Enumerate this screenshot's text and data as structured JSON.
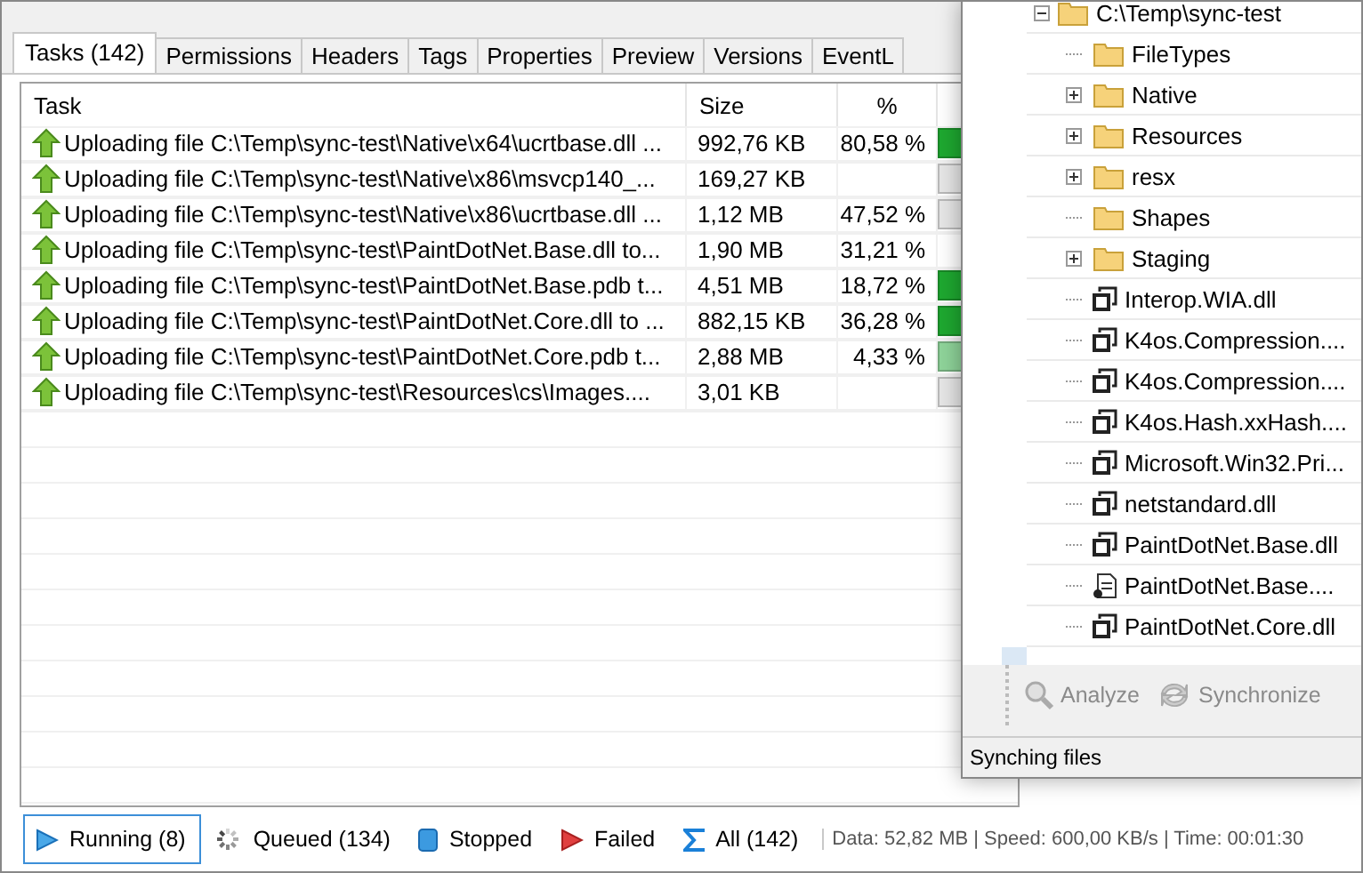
{
  "tabs": [
    {
      "label": "Tasks (142)",
      "selected": true
    },
    {
      "label": "Permissions",
      "selected": false
    },
    {
      "label": "Headers",
      "selected": false
    },
    {
      "label": "Tags",
      "selected": false
    },
    {
      "label": "Properties",
      "selected": false
    },
    {
      "label": "Preview",
      "selected": false
    },
    {
      "label": "Versions",
      "selected": false
    },
    {
      "label": "EventL",
      "selected": false
    }
  ],
  "table": {
    "columns": [
      "Task",
      "Size",
      "%"
    ],
    "rows": [
      {
        "task": "Uploading file C:\\Temp\\sync-test\\Native\\x64\\ucrtbase.dll ...",
        "size": "992,76 KB",
        "percent": "80,58 %",
        "color": "#1ea830"
      },
      {
        "task": "Uploading file C:\\Temp\\sync-test\\Native\\x86\\msvcp140_...",
        "size": "169,27 KB",
        "color": "#e6e6e6"
      },
      {
        "task": "Uploading file C:\\Temp\\sync-test\\Native\\x86\\ucrtbase.dll ...",
        "size": "1,12 MB",
        "percent": "47,52 %",
        "color": "#e6e6e6"
      },
      {
        "task": "Uploading file C:\\Temp\\sync-test\\PaintDotNet.Base.dll to...",
        "size": "1,90 MB",
        "percent": "31,21 %"
      },
      {
        "task": "Uploading file C:\\Temp\\sync-test\\PaintDotNet.Base.pdb t...",
        "size": "4,51 MB",
        "percent": "18,72 %",
        "color": "#1ea830"
      },
      {
        "task": "Uploading file C:\\Temp\\sync-test\\PaintDotNet.Core.dll to ...",
        "size": "882,15 KB",
        "percent": "36,28 %",
        "color": "#1ea830"
      },
      {
        "task": "Uploading file C:\\Temp\\sync-test\\PaintDotNet.Core.pdb t...",
        "size": "2,88 MB",
        "percent": "4,33 %",
        "color": "#8fd49a"
      },
      {
        "task": "Uploading file C:\\Temp\\sync-test\\Resources\\cs\\Images....",
        "size": "3,01 KB",
        "color": "#e6e6e6"
      }
    ]
  },
  "filters": [
    {
      "label": "Running (8)",
      "kind": "running",
      "selected": true
    },
    {
      "label": "Queued (134)",
      "kind": "queued",
      "selected": false
    },
    {
      "label": "Stopped",
      "kind": "stopped",
      "selected": false
    },
    {
      "label": "Failed",
      "kind": "failed",
      "selected": false
    },
    {
      "label": "All (142)",
      "kind": "all",
      "selected": false
    }
  ],
  "status": "Data: 52,82 MB | Speed: 600,00 KB/s | Time: 00:01:30",
  "dialog": {
    "tree": [
      {
        "label": "C:\\Temp\\sync-test",
        "kind": "folder",
        "expanded": true,
        "children": [
          {
            "label": "FileTypes",
            "kind": "folder",
            "expandable": false
          },
          {
            "label": "Native",
            "kind": "folder",
            "expandable": true
          },
          {
            "label": "Resources",
            "kind": "folder",
            "expandable": true
          },
          {
            "label": "resx",
            "kind": "folder",
            "expandable": true
          },
          {
            "label": "Shapes",
            "kind": "folder",
            "expandable": false
          },
          {
            "label": "Staging",
            "kind": "folder",
            "expandable": true
          },
          {
            "label": "Interop.WIA.dll",
            "kind": "library"
          },
          {
            "label": "K4os.Compression....",
            "kind": "library"
          },
          {
            "label": "K4os.Compression....",
            "kind": "library"
          },
          {
            "label": "K4os.Hash.xxHash....",
            "kind": "library"
          },
          {
            "label": "Microsoft.Win32.Pri...",
            "kind": "library"
          },
          {
            "label": "netstandard.dll",
            "kind": "library"
          },
          {
            "label": "PaintDotNet.Base.dll",
            "kind": "library"
          },
          {
            "label": "PaintDotNet.Base....",
            "kind": "document"
          },
          {
            "label": "PaintDotNet.Core.dll",
            "kind": "library"
          }
        ]
      }
    ],
    "toolbar": [
      {
        "label": "Analyze",
        "kind": "analyze",
        "disabled": true
      },
      {
        "label": "Synchronize",
        "kind": "sync",
        "disabled": true
      }
    ],
    "status": "Synching files"
  }
}
